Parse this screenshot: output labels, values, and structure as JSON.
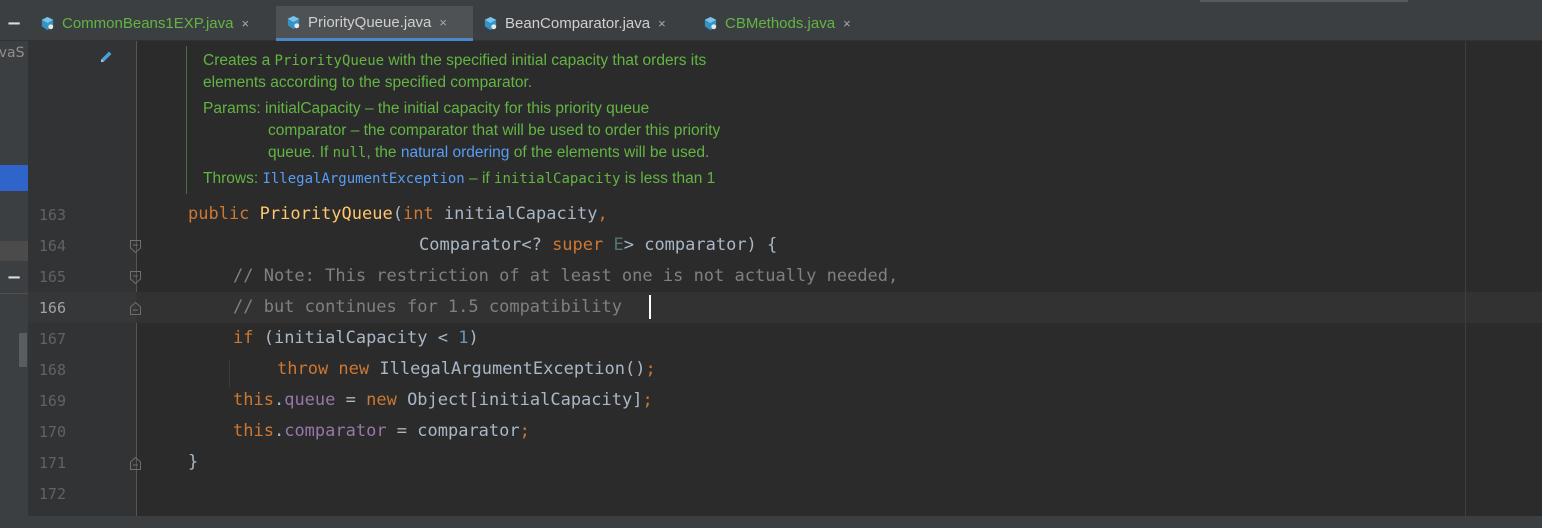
{
  "tabs": [
    {
      "label": "CommonBeans1EXP.java",
      "active": false,
      "color": "#62b543"
    },
    {
      "label": "PriorityQueue.java",
      "active": true,
      "color": "#d0d0d0"
    },
    {
      "label": "BeanComparator.java",
      "active": false,
      "color": "#d0d0d0"
    },
    {
      "label": "CBMethods.java",
      "active": false,
      "color": "#62b543"
    }
  ],
  "tab_close": "×",
  "left_panel": {
    "truncated_text": "JavaS",
    "collapse_symbol": "−"
  },
  "javadoc": {
    "line1_a": "Creates a ",
    "line1_code": "PriorityQueue",
    "line1_b": " with the specified initial capacity that orders its",
    "line2": "elements according to the specified comparator.",
    "params_label": "Params:",
    "param1": "initialCapacity – the initial capacity for this priority queue",
    "param2": "comparator – the comparator that will be used to order this priority",
    "param3_a": "queue. If ",
    "param3_code": "null",
    "param3_b": ", the ",
    "param3_link": "natural ordering",
    "param3_c": " of the elements will be used.",
    "throws_label": "Throws:",
    "throws_link": "IllegalArgumentException",
    "throws_a": " – if ",
    "throws_code": "initialCapacity",
    "throws_b": " is less than 1"
  },
  "line_numbers": [
    "163",
    "164",
    "165",
    "166",
    "167",
    "168",
    "169",
    "170",
    "171",
    "172"
  ],
  "code": {
    "l163": {
      "kw1": "public ",
      "fn": "PriorityQueue",
      "p1": "(",
      "kw2": "int",
      "p2": " initialCapacity",
      "kw3": ","
    },
    "l164": {
      "p1": "Comparator<? ",
      "kw1": "super ",
      "gen": "E",
      "p2": "> comparator) {"
    },
    "l165": "// Note: This restriction of at least one is not actually needed,",
    "l166": "// but continues for 1.5 compatibility",
    "l167": {
      "kw1": "if ",
      "p1": "(initialCapacity < ",
      "num": "1",
      "p2": ")"
    },
    "l168": {
      "kw1": "throw ",
      "kw2": "new ",
      "p1": "IllegalArgumentException()",
      "kw3": ";"
    },
    "l169": {
      "kw1": "this",
      "p1": ".",
      "fld": "queue",
      "p2": " = ",
      "kw2": "new ",
      "p3": "Object[initialCapacity]",
      "kw3": ";"
    },
    "l170": {
      "kw1": "this",
      "p1": ".",
      "fld": "comparator",
      "p2": " = comparator",
      "kw3": ";"
    },
    "l171": "}"
  },
  "colors": {
    "background": "#2b2b2b",
    "keyword": "#cc7832",
    "method": "#ffc66d",
    "comment": "#808080",
    "javadoc": "#62b543",
    "link": "#589df6",
    "field": "#9876aa",
    "number": "#6897bb",
    "active_tab_underline": "#4a88c7"
  },
  "icons": [
    "java-class-icon",
    "edit-pencil-icon",
    "fold-marker-icon"
  ]
}
